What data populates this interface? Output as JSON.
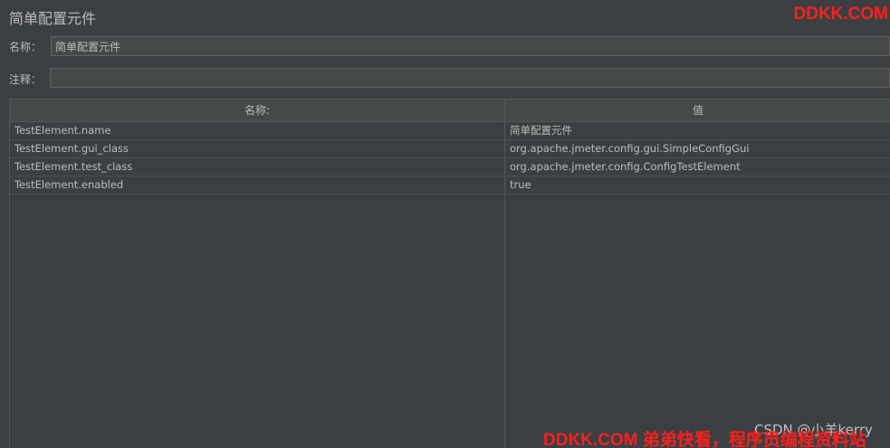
{
  "panel": {
    "title": "简单配置元件"
  },
  "form": {
    "name_label": "名称：",
    "name_value": "简单配置元件",
    "comment_label": "注释：",
    "comment_value": ""
  },
  "table": {
    "columns": [
      "名称:",
      "值"
    ],
    "rows": [
      {
        "name": "TestElement.name",
        "value": "简单配置元件"
      },
      {
        "name": "TestElement.gui_class",
        "value": "org.apache.jmeter.config.gui.SimpleConfigGui"
      },
      {
        "name": "TestElement.test_class",
        "value": "org.apache.jmeter.config.ConfigTestElement"
      },
      {
        "name": "TestElement.enabled",
        "value": "true"
      }
    ]
  },
  "watermarks": {
    "top_right": "DDKK.COM",
    "csdn": "CSDN @小羊kerry",
    "bottom": "DDKK.COM 弟弟快看，程序员编程资料站"
  },
  "colors": {
    "background": "#3c3f41",
    "input_background": "#45494a",
    "text": "#bbbbbb",
    "watermark_red": "#ff1f1f"
  }
}
